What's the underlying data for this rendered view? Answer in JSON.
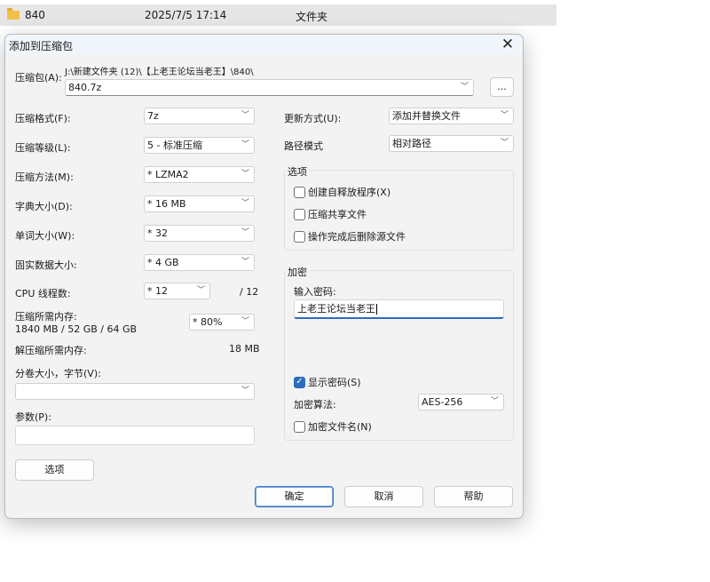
{
  "explorer_row": {
    "name": "840",
    "date": "2025/7/5 17:14",
    "type": "文件夹"
  },
  "dialog": {
    "title": "添加到压缩包",
    "close_glyph": "✕",
    "archive": {
      "label": "压缩包(A):",
      "path": "J:\\新建文件夹 (12)\\【上老王论坛当老王】\\840\\",
      "value": "840.7z",
      "browse": "..."
    },
    "left": {
      "format": {
        "label": "压缩格式(F):",
        "value": "7z"
      },
      "level": {
        "label": "压缩等级(L):",
        "value": "5 - 标准压缩"
      },
      "method": {
        "label": "压缩方法(M):",
        "value": "* LZMA2"
      },
      "dict": {
        "label": "字典大小(D):",
        "value": "* 16 MB"
      },
      "word": {
        "label": "单词大小(W):",
        "value": "* 32"
      },
      "solid": {
        "label": "固实数据大小:",
        "value": "* 4 GB"
      },
      "cpu": {
        "label": "CPU 线程数:",
        "value": "* 12",
        "max": "/ 12"
      },
      "mem_compress": {
        "label": "压缩所需内存:",
        "detail": "1840 MB / 52 GB / 64 GB",
        "value": "* 80%"
      },
      "mem_decompress": {
        "label": "解压缩所需内存:",
        "value": "18 MB"
      },
      "split": {
        "label": "分卷大小，字节(V):",
        "value": ""
      },
      "params": {
        "label": "参数(P):",
        "value": ""
      },
      "options_button": "选项"
    },
    "right": {
      "update": {
        "label": "更新方式(U):",
        "value": "添加并替换文件"
      },
      "pathmode": {
        "label": "路径模式",
        "value": "相对路径"
      },
      "options_group": {
        "title": "选项",
        "sfx": "创建自释放程序(X)",
        "shared": "压缩共享文件",
        "delete": "操作完成后删除源文件"
      },
      "encryption": {
        "title": "加密",
        "enter_password": "输入密码:",
        "password": "上老王论坛当老王",
        "show_password": "显示密码(S)",
        "method_label": "加密算法:",
        "method_value": "AES-256",
        "encrypt_names": "加密文件名(N)"
      }
    },
    "buttons": {
      "ok": "确定",
      "cancel": "取消",
      "help": "帮助"
    }
  }
}
